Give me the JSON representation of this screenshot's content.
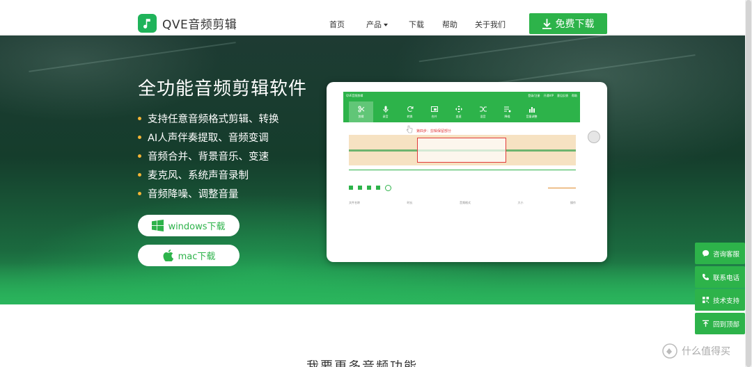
{
  "header": {
    "logo_text": "QVE音频剪辑",
    "nav": [
      "首页",
      "产品",
      "下载",
      "帮助",
      "关于我们"
    ],
    "download_label": "免费下载"
  },
  "hero": {
    "title": "全功能音频剪辑软件",
    "features": [
      "支持任意音频格式剪辑、转换",
      "AI人声伴奏提取、音频变调",
      "音频合并、背景音乐、变速",
      "麦克风、系统声音录制",
      "音频降噪、调整音量"
    ],
    "windows_label": "windows下载",
    "mac_label": "mac下载"
  },
  "mockup": {
    "app_title": "QVE音频剪辑",
    "titlebar_right": [
      "登录/注册",
      "开通VIP",
      "意见反馈",
      "帮助"
    ],
    "tools": [
      "剪辑",
      "录音",
      "转换",
      "合并",
      "变速",
      "混音",
      "降噪",
      "音量调整"
    ],
    "step_text": "第四步：剪辑保留部分",
    "list_columns": [
      "文件名称",
      "时长",
      "音频格式",
      "大小",
      "操作"
    ]
  },
  "side_panel": [
    "咨询客服",
    "联系电话",
    "技术支持",
    "回到顶部"
  ],
  "section_title": "我要更多音频功能",
  "watermark": "什么值得买",
  "colors": {
    "brand_green": "#2db34a",
    "accent_orange": "#f4b536",
    "hero_dark": "#153d2c"
  }
}
